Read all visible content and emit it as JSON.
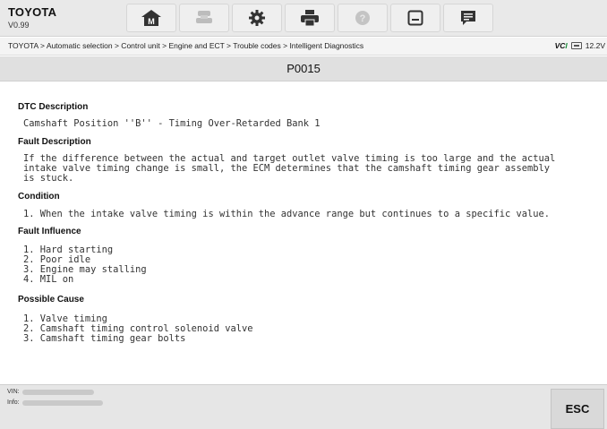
{
  "header": {
    "brand": "TOYOTA",
    "version": "V0.99",
    "toolbar": [
      {
        "icon": "home-icon",
        "badge": "M"
      },
      {
        "icon": "vehicle-swap-icon"
      },
      {
        "icon": "settings-gear-icon"
      },
      {
        "icon": "printer-icon"
      },
      {
        "icon": "help-icon"
      },
      {
        "icon": "save-icon"
      },
      {
        "icon": "data-logging-icon"
      }
    ]
  },
  "breadcrumb": "TOYOTA > Automatic selection > Control unit > Engine and ECT > Trouble codes > Intelligent Diagnostics",
  "status": {
    "vci_prefix": "VC",
    "vci_suffix": "I",
    "voltage": "12.2V"
  },
  "page_title": "P0015",
  "sections": {
    "dtc": {
      "heading": "DTC Description",
      "lines": [
        "Camshaft Position ''B'' - Timing Over-Retarded Bank 1"
      ]
    },
    "fault": {
      "heading": "Fault Description",
      "lines": [
        "If the difference between the actual and target outlet valve timing is too large and the actual",
        "intake valve timing change is small, the ECM determines that the camshaft timing gear assembly",
        "is stuck."
      ]
    },
    "condition": {
      "heading": "Condition",
      "lines": [
        "1. When the intake valve timing is within the advance range but continues to a specific value."
      ]
    },
    "influence": {
      "heading": "Fault Influence",
      "lines": [
        "1. Hard starting",
        "2. Poor idle",
        "3. Engine may stalling",
        "4. MIL on"
      ]
    },
    "cause": {
      "heading": "Possible Cause",
      "lines": [
        "1. Valve timing",
        "2. Camshaft timing control solenoid valve",
        "3. Camshaft timing gear bolts"
      ]
    }
  },
  "footer": {
    "vin_label": "VIN:",
    "info_label": "Info:",
    "esc_label": "ESC"
  }
}
